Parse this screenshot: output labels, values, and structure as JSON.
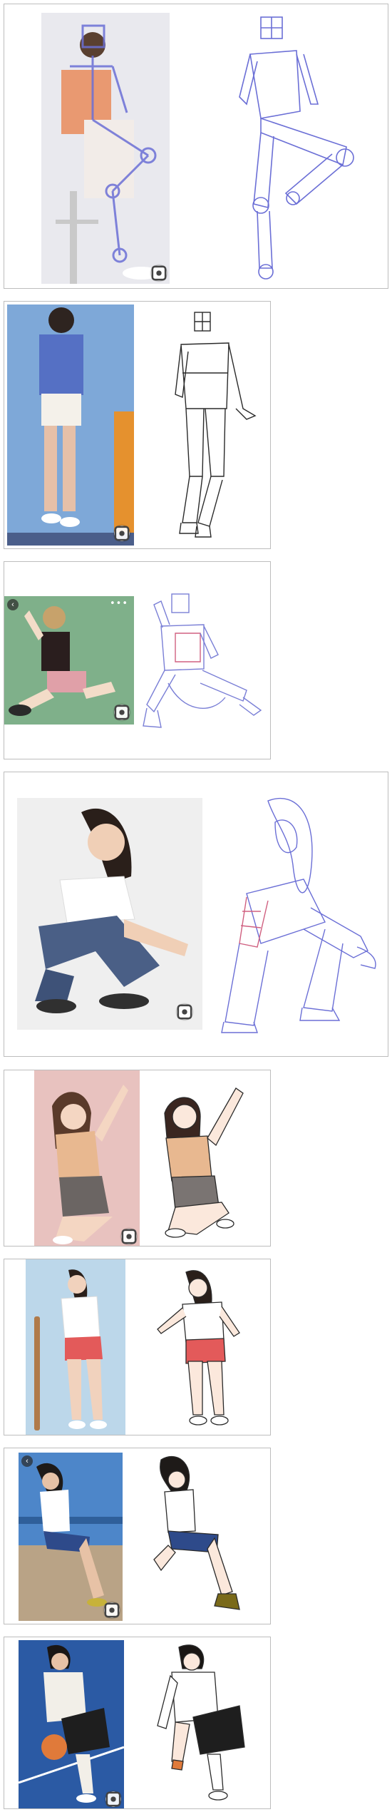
{
  "icons": {
    "lens": "visual-search-icon",
    "back": "chevron-left-icon",
    "more": "more-dots-icon"
  },
  "glyphs": {
    "back": "‹",
    "more": "•••"
  },
  "colors": {
    "border": "#bdbdbd",
    "sketch_blue": "#6b6fd6",
    "sketch_red": "#d06080",
    "line_art": "#2a2a2a"
  },
  "panels": [
    {
      "id": "seated-stool",
      "left_bg": "#e9e9ee",
      "accent": "#e98b5a"
    },
    {
      "id": "leaning-crates",
      "left_bg": "#7ea8d8",
      "accent": "#5570c4"
    },
    {
      "id": "floor-sit-green",
      "left_bg": "#7fb08a",
      "accent": "#e0a0a8"
    },
    {
      "id": "squat-denim",
      "left_bg": "#efefef",
      "accent": "#4a5f86"
    },
    {
      "id": "kneel-pink",
      "left_bg": "#e8c2bf",
      "accent": "#e8b890"
    },
    {
      "id": "skateboard",
      "left_bg": "#bcd7ea",
      "accent": "#e35a5a"
    },
    {
      "id": "seaside-wall",
      "left_bg": "#4d86c9",
      "accent": "#2e4a8a"
    },
    {
      "id": "basketball",
      "left_bg": "#2b5aa4",
      "accent": "#e07a3a"
    }
  ]
}
